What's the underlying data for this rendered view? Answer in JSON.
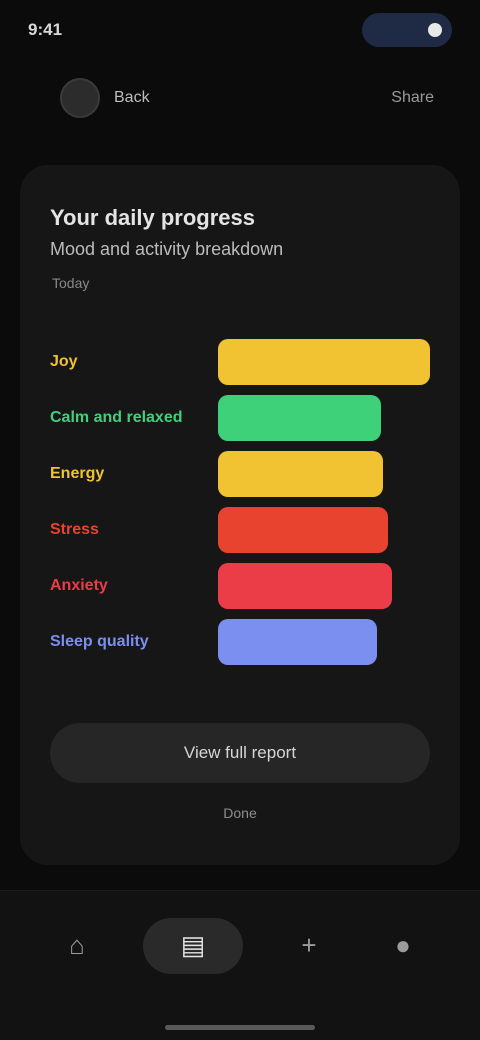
{
  "status_bar": {
    "time": "9:41"
  },
  "top_nav": {
    "left_label": "Back",
    "right_label": "Share"
  },
  "card": {
    "title": "Your daily progress",
    "subtitle": "Mood and activity breakdown",
    "meta": "Today",
    "rows": [
      {
        "label": "Joy",
        "color": "#f1c232",
        "fraction": 1.0
      },
      {
        "label": "Calm and relaxed",
        "color": "#3fd179",
        "fraction": 0.77
      },
      {
        "label": "Energy",
        "color": "#f1c232",
        "fraction": 0.78
      },
      {
        "label": "Stress",
        "color": "#e8432f",
        "fraction": 0.8
      },
      {
        "label": "Anxiety",
        "color": "#ea3d47",
        "fraction": 0.82
      },
      {
        "label": "Sleep quality",
        "color": "#7a8ff0",
        "fraction": 0.75
      }
    ],
    "button_label": "View full report",
    "footnote": "Done"
  },
  "bottom_nav": {
    "items": [
      {
        "icon": "home-icon",
        "glyph": "⌂"
      },
      {
        "icon": "stats-icon",
        "glyph": "▤"
      },
      {
        "icon": "plus-icon",
        "glyph": "+"
      },
      {
        "icon": "profile-icon",
        "glyph": "●"
      }
    ]
  }
}
